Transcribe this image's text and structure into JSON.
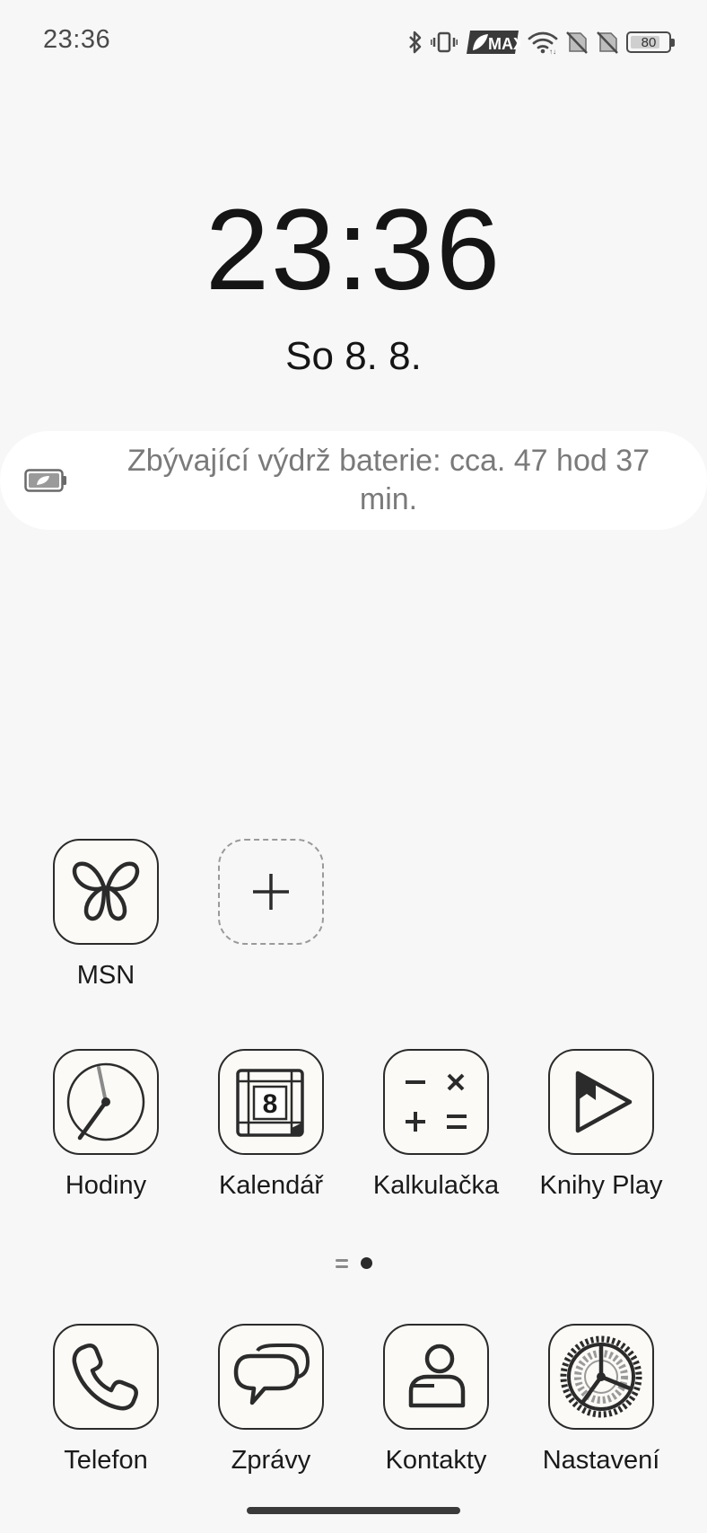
{
  "status_bar": {
    "time": "23:36",
    "network_badge": "MAX",
    "battery_percent": "80",
    "battery_level": 0.8,
    "icons": [
      "bluetooth-icon",
      "vibrate-icon",
      "max-badge-icon",
      "wifi-icon",
      "no-sim-icon",
      "no-sim-icon",
      "battery-icon"
    ]
  },
  "lockscreen": {
    "clock": "23:36",
    "date": "So 8. 8."
  },
  "battery_info": {
    "text": "Zbývající výdrž baterie: cca. 47 hod 37 min.",
    "icon": "battery-leaf-icon"
  },
  "home": {
    "row1": [
      {
        "label": "MSN",
        "icon": "butterfly-icon"
      }
    ],
    "add_slot_icon": "plus-icon",
    "row2": [
      {
        "label": "Hodiny",
        "icon": "clock-icon"
      },
      {
        "label": "Kalendář",
        "icon": "calendar-icon",
        "badge": "8"
      },
      {
        "label": "Kalkulačka",
        "icon": "calculator-icon"
      },
      {
        "label": "Knihy Play",
        "icon": "play-books-icon"
      }
    ],
    "dock": [
      {
        "label": "Telefon",
        "icon": "phone-icon"
      },
      {
        "label": "Zprávy",
        "icon": "messages-icon"
      },
      {
        "label": "Kontakty",
        "icon": "contacts-icon"
      },
      {
        "label": "Nastavení",
        "icon": "settings-gear-icon"
      }
    ]
  },
  "page_indicator": {
    "pages": 2,
    "current": 2
  },
  "colors": {
    "background": "#f7f7f7",
    "pill_background": "#ffffff",
    "icon_fill": "#fbfaf6",
    "icon_stroke": "#2b2b2b",
    "secondary_text": "#7a7a7a"
  }
}
